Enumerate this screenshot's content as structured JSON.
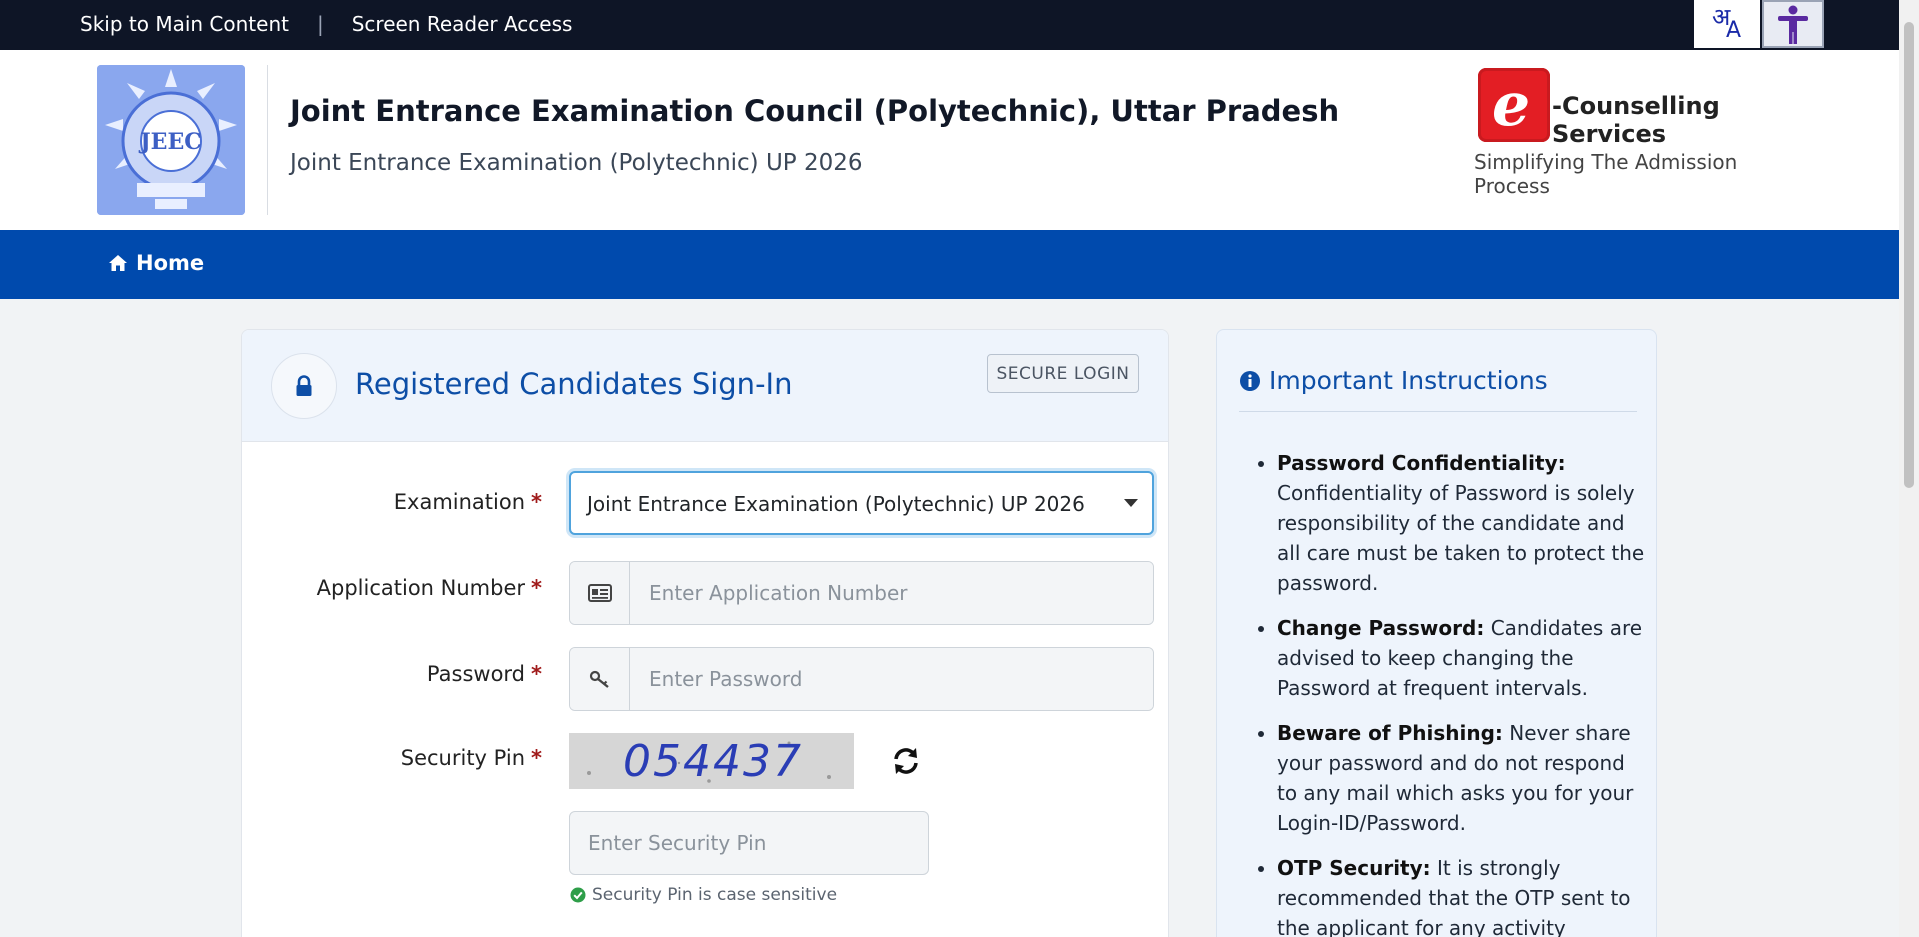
{
  "topbar": {
    "skip_link": "Skip to Main Content",
    "separator": "|",
    "screen_reader": "Screen Reader Access",
    "lang_glyph_1": "अ",
    "lang_glyph_2": "A"
  },
  "header": {
    "title": "Joint Entrance Examination Council (Polytechnic), Uttar Pradesh",
    "subtitle": "Joint Entrance Examination (Polytechnic) UP 2026",
    "ecounselling": {
      "letter": "e",
      "title": "-Counselling Services",
      "tagline": "Simplifying The Admission Process"
    }
  },
  "nav": {
    "home_label": "Home"
  },
  "login": {
    "title": "Registered Candidates Sign-In",
    "badge": "SECURE LOGIN",
    "required_mark": "*",
    "examination": {
      "label": "Examination",
      "selected": "Joint Entrance Examination (Polytechnic) UP 2026"
    },
    "application_number": {
      "label": "Application Number",
      "placeholder": "Enter Application Number",
      "value": ""
    },
    "password": {
      "label": "Password",
      "placeholder": "Enter Password",
      "value": ""
    },
    "security_pin": {
      "label": "Security Pin",
      "captcha": "054437",
      "placeholder": "Enter Security Pin",
      "value": "",
      "hint": "Security Pin is case sensitive"
    }
  },
  "instructions": {
    "title": "Important Instructions",
    "items": [
      {
        "heading": "Password Confidentiality:",
        "text": "Confidentiality of Password is solely responsibility of the candidate and all care must be taken to protect the password."
      },
      {
        "heading": "Change Password:",
        "text": "Candidates are advised to keep changing the Password at frequent intervals."
      },
      {
        "heading": "Beware of Phishing:",
        "text": "Never share your password and do not respond to any mail which asks you for your Login-ID/Password."
      },
      {
        "heading": "OTP Security:",
        "text": "It is strongly recommended that the OTP sent to the applicant for any activity"
      }
    ]
  },
  "colors": {
    "topbar": "#0e1526",
    "nav": "#004aad",
    "accent": "#0d4ea6",
    "required": "#a01b1b"
  }
}
